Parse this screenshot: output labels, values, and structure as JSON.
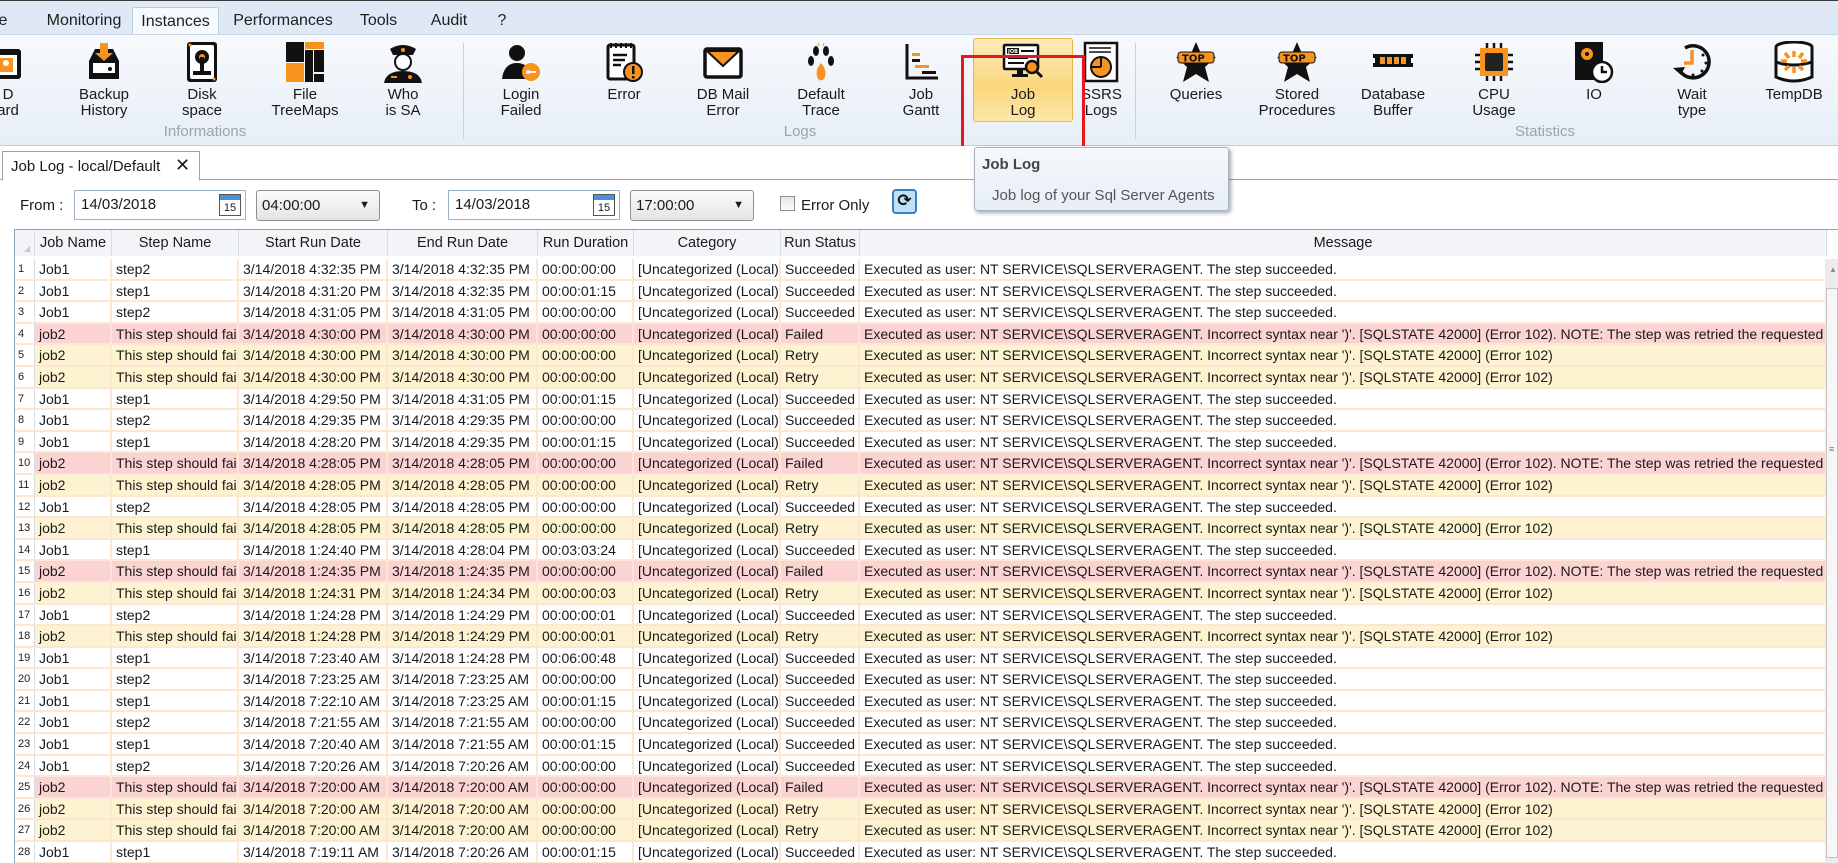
{
  "ribbon_tabs": [
    {
      "label": "e",
      "active": false
    },
    {
      "label": "Monitoring",
      "active": false
    },
    {
      "label": "Instances",
      "active": true
    },
    {
      "label": "Performances",
      "active": false
    },
    {
      "label": "Tools",
      "active": false
    },
    {
      "label": "Audit",
      "active": false
    },
    {
      "label": "?",
      "active": false
    }
  ],
  "ribbon": {
    "groups": [
      {
        "label": "Informations"
      },
      {
        "label": "Logs"
      },
      {
        "label": "Statistics"
      }
    ],
    "buttons": [
      {
        "id": "id-card",
        "label": "ID\nCard",
        "visible_label": "D\nard",
        "icon": "id-card-icon"
      },
      {
        "id": "backup-history",
        "label": "Backup\nHistory",
        "icon": "backup-inbox-icon"
      },
      {
        "id": "disk-space",
        "label": "Disk\nspace",
        "icon": "hard-disk-icon"
      },
      {
        "id": "file-treemaps",
        "label": "File\nTreeMaps",
        "icon": "treemap-icon"
      },
      {
        "id": "who-is-sa",
        "label": "Who\nis SA",
        "icon": "police-officer-icon"
      },
      {
        "id": "login-failed",
        "label": "Login\nFailed",
        "icon": "user-key-icon"
      },
      {
        "id": "error",
        "label": "Error",
        "icon": "notepad-warning-icon"
      },
      {
        "id": "db-mail-error",
        "label": "DB Mail\nError",
        "icon": "envelope-icon"
      },
      {
        "id": "default-trace",
        "label": "Default\nTrace",
        "icon": "paw-print-icon"
      },
      {
        "id": "job-gantt",
        "label": "Job\nGantt",
        "icon": "gantt-chart-icon"
      },
      {
        "id": "job-log",
        "label": "Job\nLog",
        "icon": "job-monitor-search-icon",
        "selected": true
      },
      {
        "id": "ssrs-logs",
        "label": "SSRS\nLogs",
        "visible_label": "SSRS\nLogs",
        "icon": "report-pie-icon"
      },
      {
        "id": "top-queries",
        "label": "Queries",
        "icon": "top-star-icon"
      },
      {
        "id": "top-stored-procedures",
        "label": "Stored\nProcedures",
        "icon": "top-star-icon"
      },
      {
        "id": "database-buffer",
        "label": "Database\nBuffer",
        "icon": "memory-module-icon"
      },
      {
        "id": "cpu-usage",
        "label": "CPU\nUsage",
        "icon": "cpu-chip-icon"
      },
      {
        "id": "io",
        "label": "IO",
        "icon": "disk-clock-icon"
      },
      {
        "id": "wait-type",
        "label": "Wait\ntype",
        "icon": "clock-refresh-icon"
      },
      {
        "id": "tempdb",
        "label": "TempDB",
        "icon": "database-burst-icon"
      }
    ]
  },
  "tooltip": {
    "title": "Job Log",
    "description": "Job log of your Sql Server Agents"
  },
  "document_tab": {
    "title": "Job Log - local/Default",
    "close_glyph": "✕"
  },
  "filter": {
    "from_label": "From :",
    "from_date": "14/03/2018",
    "from_time": "04:00:00",
    "to_label": "To :",
    "to_date": "14/03/2018",
    "to_time": "17:00:00",
    "calendar_day": "15",
    "error_only_label": "Error Only",
    "error_only_checked": false,
    "refresh_icon": "refresh-icon"
  },
  "grid": {
    "columns": [
      "Job Name",
      "Step Name",
      "Start Run Date",
      "End Run Date",
      "Run Duration",
      "Category",
      "Run Status",
      "Message"
    ],
    "status_colors": {
      "Failed": "#fcd3d3",
      "Retry": "#fdf3d0",
      "Succeeded": "#ffffff"
    },
    "rows": [
      {
        "n": "1",
        "job": "Job1",
        "step": "step2",
        "start": "3/14/2018 4:32:35 PM",
        "end": "3/14/2018 4:32:35 PM",
        "duration": "00:00:00:00",
        "category": "[Uncategorized (Local)]",
        "status": "Succeeded",
        "message": "Executed as user: NT SERVICE\\SQLSERVERAGENT. The step succeeded."
      },
      {
        "n": "2",
        "job": "Job1",
        "step": "step1",
        "start": "3/14/2018 4:31:20 PM",
        "end": "3/14/2018 4:32:35 PM",
        "duration": "00:00:01:15",
        "category": "[Uncategorized (Local)]",
        "status": "Succeeded",
        "message": "Executed as user: NT SERVICE\\SQLSERVERAGENT. The step succeeded."
      },
      {
        "n": "3",
        "job": "Job1",
        "step": "step2",
        "start": "3/14/2018 4:31:05 PM",
        "end": "3/14/2018 4:31:05 PM",
        "duration": "00:00:00:00",
        "category": "[Uncategorized (Local)]",
        "status": "Succeeded",
        "message": "Executed as user: NT SERVICE\\SQLSERVERAGENT. The step succeeded."
      },
      {
        "n": "4",
        "job": "job2",
        "step": "This step should fail",
        "start": "3/14/2018 4:30:00 PM",
        "end": "3/14/2018 4:30:00 PM",
        "duration": "00:00:00:00",
        "category": "[Uncategorized (Local)]",
        "status": "Failed",
        "message": "Executed as user: NT SERVICE\\SQLSERVERAGENT. Incorrect syntax near ')'. [SQLSTATE 42000] (Error 102).  NOTE: The step was retried the requested number of"
      },
      {
        "n": "5",
        "job": "job2",
        "step": "This step should fail",
        "start": "3/14/2018 4:30:00 PM",
        "end": "3/14/2018 4:30:00 PM",
        "duration": "00:00:00:00",
        "category": "[Uncategorized (Local)]",
        "status": "Retry",
        "message": "Executed as user: NT SERVICE\\SQLSERVERAGENT. Incorrect syntax near ')'. [SQLSTATE 42000] (Error 102)"
      },
      {
        "n": "6",
        "job": "job2",
        "step": "This step should fail",
        "start": "3/14/2018 4:30:00 PM",
        "end": "3/14/2018 4:30:00 PM",
        "duration": "00:00:00:00",
        "category": "[Uncategorized (Local)]",
        "status": "Retry",
        "message": "Executed as user: NT SERVICE\\SQLSERVERAGENT. Incorrect syntax near ')'. [SQLSTATE 42000] (Error 102)"
      },
      {
        "n": "7",
        "job": "Job1",
        "step": "step1",
        "start": "3/14/2018 4:29:50 PM",
        "end": "3/14/2018 4:31:05 PM",
        "duration": "00:00:01:15",
        "category": "[Uncategorized (Local)]",
        "status": "Succeeded",
        "message": "Executed as user: NT SERVICE\\SQLSERVERAGENT. The step succeeded."
      },
      {
        "n": "8",
        "job": "Job1",
        "step": "step2",
        "start": "3/14/2018 4:29:35 PM",
        "end": "3/14/2018 4:29:35 PM",
        "duration": "00:00:00:00",
        "category": "[Uncategorized (Local)]",
        "status": "Succeeded",
        "message": "Executed as user: NT SERVICE\\SQLSERVERAGENT. The step succeeded."
      },
      {
        "n": "9",
        "job": "Job1",
        "step": "step1",
        "start": "3/14/2018 4:28:20 PM",
        "end": "3/14/2018 4:29:35 PM",
        "duration": "00:00:01:15",
        "category": "[Uncategorized (Local)]",
        "status": "Succeeded",
        "message": "Executed as user: NT SERVICE\\SQLSERVERAGENT. The step succeeded."
      },
      {
        "n": "10",
        "job": "job2",
        "step": "This step should fail",
        "start": "3/14/2018 4:28:05 PM",
        "end": "3/14/2018 4:28:05 PM",
        "duration": "00:00:00:00",
        "category": "[Uncategorized (Local)]",
        "status": "Failed",
        "message": "Executed as user: NT SERVICE\\SQLSERVERAGENT. Incorrect syntax near ')'. [SQLSTATE 42000] (Error 102).  NOTE: The step was retried the requested number of"
      },
      {
        "n": "11",
        "job": "job2",
        "step": "This step should fail",
        "start": "3/14/2018 4:28:05 PM",
        "end": "3/14/2018 4:28:05 PM",
        "duration": "00:00:00:00",
        "category": "[Uncategorized (Local)]",
        "status": "Retry",
        "message": "Executed as user: NT SERVICE\\SQLSERVERAGENT. Incorrect syntax near ')'. [SQLSTATE 42000] (Error 102)"
      },
      {
        "n": "12",
        "job": "Job1",
        "step": "step2",
        "start": "3/14/2018 4:28:05 PM",
        "end": "3/14/2018 4:28:05 PM",
        "duration": "00:00:00:00",
        "category": "[Uncategorized (Local)]",
        "status": "Succeeded",
        "message": "Executed as user: NT SERVICE\\SQLSERVERAGENT. The step succeeded."
      },
      {
        "n": "13",
        "job": "job2",
        "step": "This step should fail",
        "start": "3/14/2018 4:28:05 PM",
        "end": "3/14/2018 4:28:05 PM",
        "duration": "00:00:00:00",
        "category": "[Uncategorized (Local)]",
        "status": "Retry",
        "message": "Executed as user: NT SERVICE\\SQLSERVERAGENT. Incorrect syntax near ')'. [SQLSTATE 42000] (Error 102)"
      },
      {
        "n": "14",
        "job": "Job1",
        "step": "step1",
        "start": "3/14/2018 1:24:40 PM",
        "end": "3/14/2018 4:28:04 PM",
        "duration": "00:03:03:24",
        "category": "[Uncategorized (Local)]",
        "status": "Succeeded",
        "message": "Executed as user: NT SERVICE\\SQLSERVERAGENT. The step succeeded."
      },
      {
        "n": "15",
        "job": "job2",
        "step": "This step should fail",
        "start": "3/14/2018 1:24:35 PM",
        "end": "3/14/2018 1:24:35 PM",
        "duration": "00:00:00:00",
        "category": "[Uncategorized (Local)]",
        "status": "Failed",
        "message": "Executed as user: NT SERVICE\\SQLSERVERAGENT. Incorrect syntax near ')'. [SQLSTATE 42000] (Error 102).  NOTE: The step was retried the requested number of"
      },
      {
        "n": "16",
        "job": "job2",
        "step": "This step should fail",
        "start": "3/14/2018 1:24:31 PM",
        "end": "3/14/2018 1:24:34 PM",
        "duration": "00:00:00:03",
        "category": "[Uncategorized (Local)]",
        "status": "Retry",
        "message": "Executed as user: NT SERVICE\\SQLSERVERAGENT. Incorrect syntax near ')'. [SQLSTATE 42000] (Error 102)"
      },
      {
        "n": "17",
        "job": "Job1",
        "step": "step2",
        "start": "3/14/2018 1:24:28 PM",
        "end": "3/14/2018 1:24:29 PM",
        "duration": "00:00:00:01",
        "category": "[Uncategorized (Local)]",
        "status": "Succeeded",
        "message": "Executed as user: NT SERVICE\\SQLSERVERAGENT. The step succeeded."
      },
      {
        "n": "18",
        "job": "job2",
        "step": "This step should fail",
        "start": "3/14/2018 1:24:28 PM",
        "end": "3/14/2018 1:24:29 PM",
        "duration": "00:00:00:01",
        "category": "[Uncategorized (Local)]",
        "status": "Retry",
        "message": "Executed as user: NT SERVICE\\SQLSERVERAGENT. Incorrect syntax near ')'. [SQLSTATE 42000] (Error 102)"
      },
      {
        "n": "19",
        "job": "Job1",
        "step": "step1",
        "start": "3/14/2018 7:23:40 AM",
        "end": "3/14/2018 1:24:28 PM",
        "duration": "00:06:00:48",
        "category": "[Uncategorized (Local)]",
        "status": "Succeeded",
        "message": "Executed as user: NT SERVICE\\SQLSERVERAGENT. The step succeeded."
      },
      {
        "n": "20",
        "job": "Job1",
        "step": "step2",
        "start": "3/14/2018 7:23:25 AM",
        "end": "3/14/2018 7:23:25 AM",
        "duration": "00:00:00:00",
        "category": "[Uncategorized (Local)]",
        "status": "Succeeded",
        "message": "Executed as user: NT SERVICE\\SQLSERVERAGENT. The step succeeded."
      },
      {
        "n": "21",
        "job": "Job1",
        "step": "step1",
        "start": "3/14/2018 7:22:10 AM",
        "end": "3/14/2018 7:23:25 AM",
        "duration": "00:00:01:15",
        "category": "[Uncategorized (Local)]",
        "status": "Succeeded",
        "message": "Executed as user: NT SERVICE\\SQLSERVERAGENT. The step succeeded."
      },
      {
        "n": "22",
        "job": "Job1",
        "step": "step2",
        "start": "3/14/2018 7:21:55 AM",
        "end": "3/14/2018 7:21:55 AM",
        "duration": "00:00:00:00",
        "category": "[Uncategorized (Local)]",
        "status": "Succeeded",
        "message": "Executed as user: NT SERVICE\\SQLSERVERAGENT. The step succeeded."
      },
      {
        "n": "23",
        "job": "Job1",
        "step": "step1",
        "start": "3/14/2018 7:20:40 AM",
        "end": "3/14/2018 7:21:55 AM",
        "duration": "00:00:01:15",
        "category": "[Uncategorized (Local)]",
        "status": "Succeeded",
        "message": "Executed as user: NT SERVICE\\SQLSERVERAGENT. The step succeeded."
      },
      {
        "n": "24",
        "job": "Job1",
        "step": "step2",
        "start": "3/14/2018 7:20:26 AM",
        "end": "3/14/2018 7:20:26 AM",
        "duration": "00:00:00:00",
        "category": "[Uncategorized (Local)]",
        "status": "Succeeded",
        "message": "Executed as user: NT SERVICE\\SQLSERVERAGENT. The step succeeded."
      },
      {
        "n": "25",
        "job": "job2",
        "step": "This step should fail",
        "start": "3/14/2018 7:20:00 AM",
        "end": "3/14/2018 7:20:00 AM",
        "duration": "00:00:00:00",
        "category": "[Uncategorized (Local)]",
        "status": "Failed",
        "message": "Executed as user: NT SERVICE\\SQLSERVERAGENT. Incorrect syntax near ')'. [SQLSTATE 42000] (Error 102).  NOTE: The step was retried the requested number of"
      },
      {
        "n": "26",
        "job": "job2",
        "step": "This step should fail",
        "start": "3/14/2018 7:20:00 AM",
        "end": "3/14/2018 7:20:00 AM",
        "duration": "00:00:00:00",
        "category": "[Uncategorized (Local)]",
        "status": "Retry",
        "message": "Executed as user: NT SERVICE\\SQLSERVERAGENT. Incorrect syntax near ')'. [SQLSTATE 42000] (Error 102)"
      },
      {
        "n": "27",
        "job": "job2",
        "step": "This step should fail",
        "start": "3/14/2018 7:20:00 AM",
        "end": "3/14/2018 7:20:00 AM",
        "duration": "00:00:00:00",
        "category": "[Uncategorized (Local)]",
        "status": "Retry",
        "message": "Executed as user: NT SERVICE\\SQLSERVERAGENT. Incorrect syntax near ')'. [SQLSTATE 42000] (Error 102)"
      },
      {
        "n": "28",
        "job": "Job1",
        "step": "step1",
        "start": "3/14/2018 7:19:11 AM",
        "end": "3/14/2018 7:20:26 AM",
        "duration": "00:00:01:15",
        "category": "[Uncategorized (Local)]",
        "status": "Succeeded",
        "message": "Executed as user: NT SERVICE\\SQLSERVERAGENT. The step succeeded."
      }
    ]
  }
}
